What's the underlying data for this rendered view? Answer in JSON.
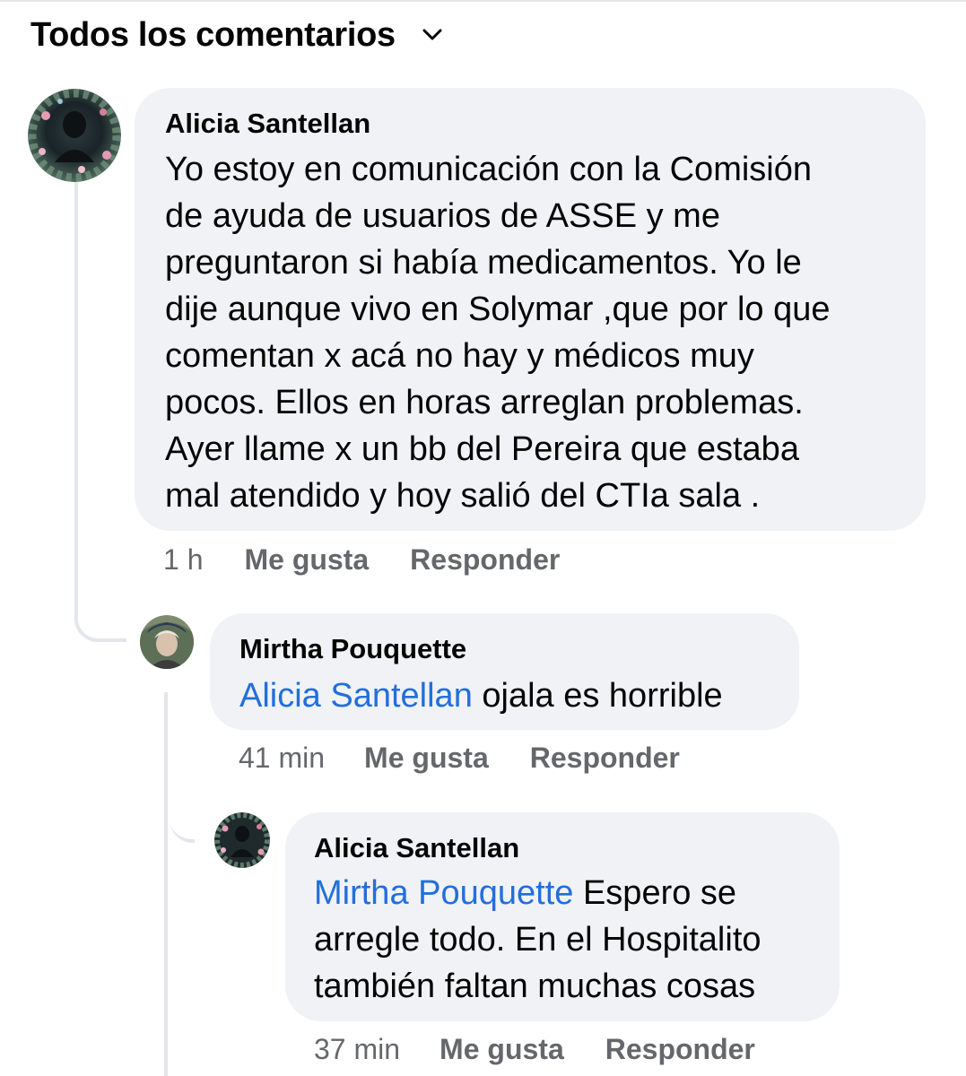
{
  "header": {
    "title": "Todos los comentarios",
    "chevron_icon": "chevron-down-icon"
  },
  "colors": {
    "mention": "#216fdb",
    "bubble": "#f0f2f5",
    "meta": "#65676b",
    "thread_line": "#e4e6eb"
  },
  "comments": [
    {
      "author": "Alicia Santellan",
      "text_lines": [
        "Yo estoy en comunicación con la Comisión",
        "de ayuda de usuarios de ASSE y me",
        "preguntaron si había medicamentos. Yo le",
        "dije aunque vivo en Solymar ,que por lo que",
        "comentan x acá no hay y médicos muy",
        "pocos. Ellos en horas arreglan problemas.",
        "Ayer llame x un bb del Pereira que estaba",
        "mal atendido y hoy salió del CTIa sala ."
      ],
      "time": "1 h",
      "like_label": "Me gusta",
      "reply_label": "Responder"
    },
    {
      "author": "Mirtha Pouquette",
      "mention": "Alicia Santellan",
      "text_lines": [
        " ojala es horrible"
      ],
      "time": "41 min",
      "like_label": "Me gusta",
      "reply_label": "Responder"
    },
    {
      "author": "Alicia Santellan",
      "mention": "Mirtha Pouquette",
      "text_lines": [
        " Espero se",
        "arregle todo. En el Hospitalito",
        "también faltan muchas cosas"
      ],
      "time": "37 min",
      "like_label": "Me gusta",
      "reply_label": "Responder"
    }
  ]
}
